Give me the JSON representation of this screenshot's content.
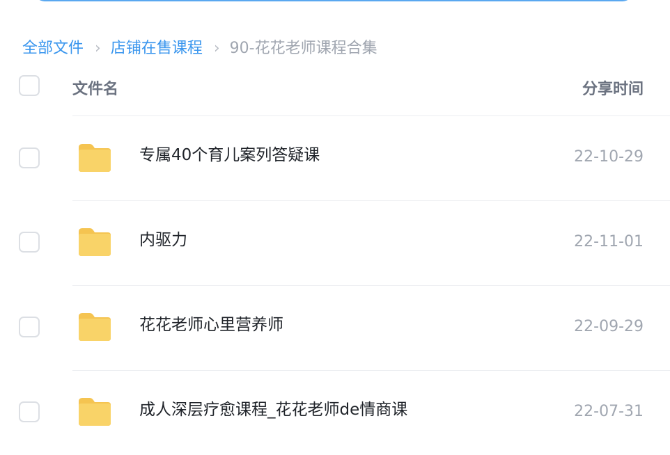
{
  "breadcrumb": {
    "items": [
      "全部文件",
      "店铺在售课程"
    ],
    "current": "90-花花老师课程合集",
    "separator": "›"
  },
  "table": {
    "header_name": "文件名",
    "header_time": "分享时间",
    "rows": [
      {
        "name": "专属40个育儿案列答疑课",
        "time": "22-10-29",
        "icon": "folder-icon"
      },
      {
        "name": "内驱力",
        "time": "22-11-01",
        "icon": "folder-icon"
      },
      {
        "name": "花花老师心里营养师",
        "time": "22-09-29",
        "icon": "folder-icon"
      },
      {
        "name": "成人深层疗愈课程_花花老师de情商课",
        "time": "22-07-31",
        "icon": "folder-icon"
      }
    ]
  },
  "colors": {
    "link": "#3a96ee",
    "folder": "#f9d368",
    "muted": "#a0a6b0",
    "text": "#1f2329"
  }
}
